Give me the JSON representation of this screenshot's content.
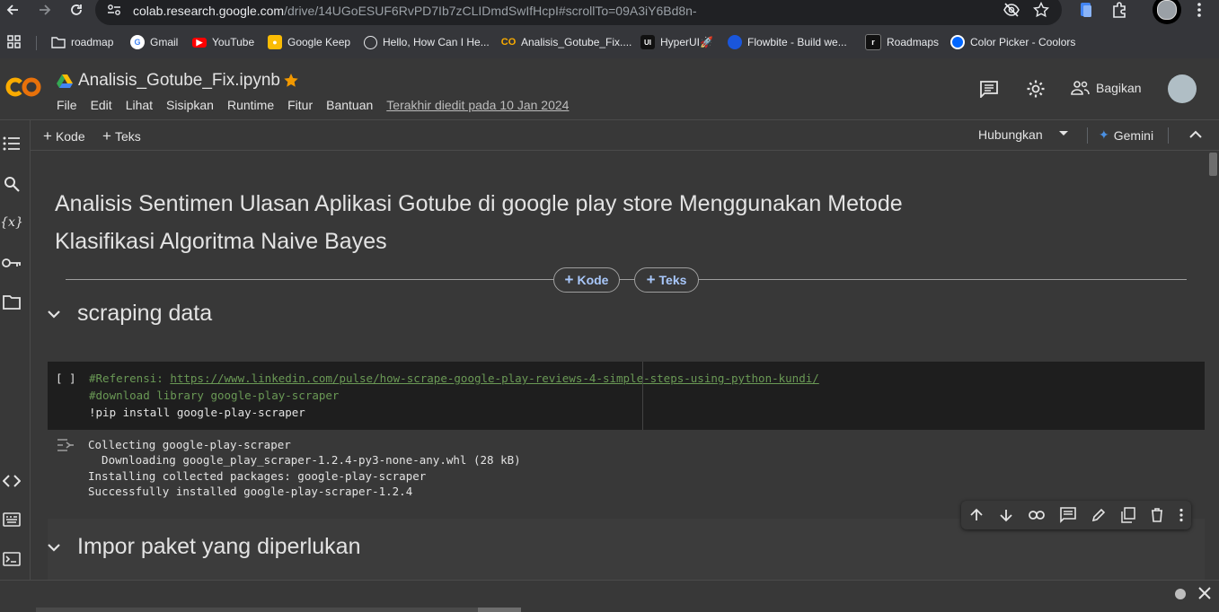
{
  "browser": {
    "url_host": "colab.research.google.com",
    "url_path": "/drive/14UGoESUF6RvPD7Ib7zCLIDmdSwIfHcpI#scrollTo=09A3iY6Bd8n-",
    "bookmarks": [
      {
        "label": "roadmap",
        "icon": "folder-icon"
      },
      {
        "label": "Gmail",
        "icon": "google-icon"
      },
      {
        "label": "YouTube",
        "icon": "youtube-icon"
      },
      {
        "label": "Google Keep",
        "icon": "keep-icon"
      },
      {
        "label": "Hello, How Can I He...",
        "icon": "openai-icon"
      },
      {
        "label": "Analisis_Gotube_Fix....",
        "icon": "colab-icon"
      },
      {
        "label": "HyperUI🚀",
        "icon": "hyperui-icon"
      },
      {
        "label": "Flowbite - Build we...",
        "icon": "flowbite-icon"
      },
      {
        "label": "Roadmaps",
        "icon": "roadmaps-icon"
      },
      {
        "label": "Color Picker - Coolors",
        "icon": "coolors-icon"
      }
    ]
  },
  "colab": {
    "notebook_title": "Analisis_Gotube_Fix.ipynb",
    "menu": [
      "File",
      "Edit",
      "Lihat",
      "Sisipkan",
      "Runtime",
      "Fitur",
      "Bantuan"
    ],
    "last_edited": "Terakhir diedit pada 10 Jan 2024",
    "share_label": "Bagikan",
    "toolbar": {
      "add_code": "Kode",
      "add_text": "Teks",
      "connect": "Hubungkan",
      "gemini": "Gemini"
    }
  },
  "notebook": {
    "heading": "Analisis Sentimen Ulasan Aplikasi Gotube di google play store Menggunakan Metode Klasifikasi Algoritma Naive Bayes",
    "add_code_pill": "Kode",
    "add_text_pill": "Teks",
    "section1": "scraping data",
    "code_cell": {
      "run_indicator": "[ ]",
      "line1_prefix": "#Referensi: ",
      "line1_link": "https://www.linkedin.com/pulse/how-scrape-google-play-reviews-4-simple-steps-using-python-kundi/",
      "line2": "#download library google-play-scraper",
      "line3": "!pip install google-play-scraper"
    },
    "output_lines": [
      "Collecting google-play-scraper",
      "  Downloading google_play_scraper-1.2.4-py3-none-any.whl (28 kB)",
      "Installing collected packages: google-play-scraper",
      "Successfully installed google-play-scraper-1.2.4"
    ],
    "section2": "Impor paket yang diperlukan"
  },
  "colors": {
    "colab_orange": "#f9ab00",
    "link_blue": "#a8c7fa",
    "comment_green": "#6a9955"
  }
}
